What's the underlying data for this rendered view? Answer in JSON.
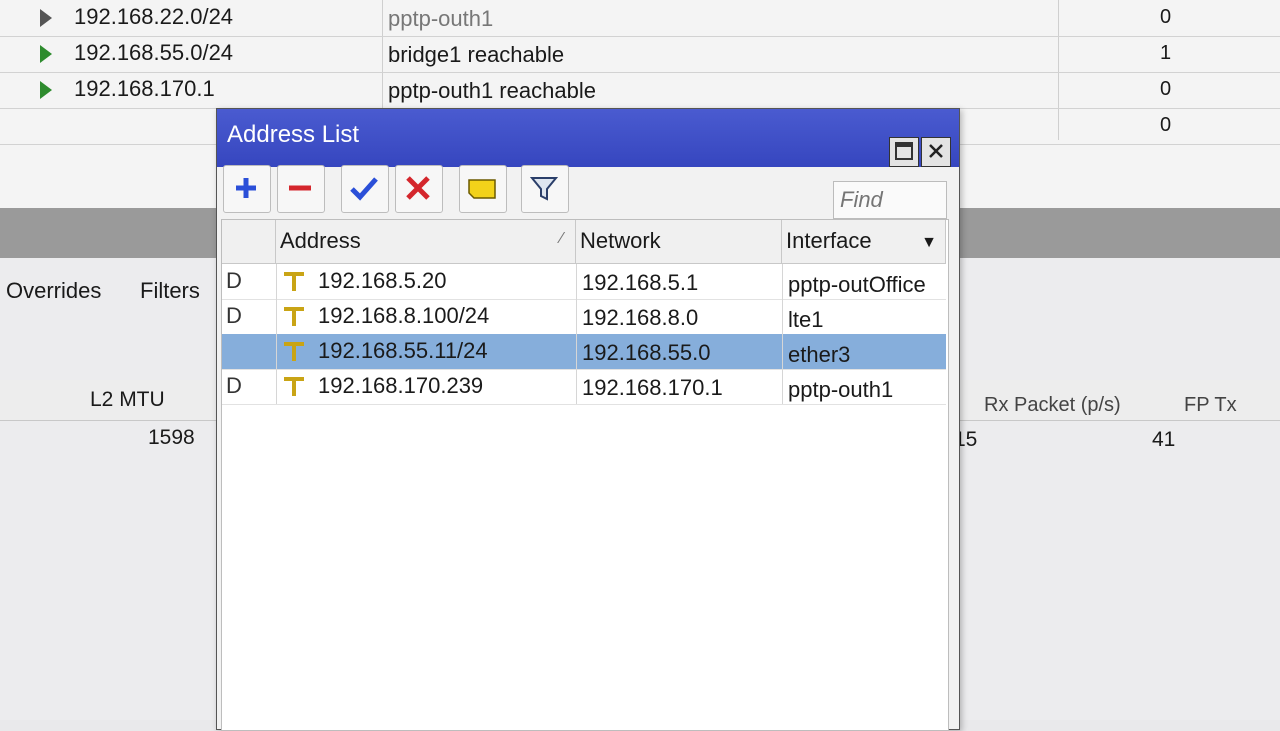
{
  "routes": [
    {
      "dst": "192.168.22.0/24",
      "gateway": "pptp-outh1",
      "distance": "0",
      "active": false
    },
    {
      "dst": "192.168.55.0/24",
      "gateway": "bridge1 reachable",
      "distance": "1",
      "active": true
    },
    {
      "dst": "192.168.170.1",
      "gateway": "pptp-outh1 reachable",
      "distance": "0",
      "active": true
    },
    {
      "dst": "",
      "gateway": "",
      "distance": "0",
      "active": false
    }
  ],
  "background": {
    "tabs": [
      "Overrides",
      "Filters"
    ],
    "l2mtu_header": "L2 MTU",
    "l2mtu_value": "1598",
    "rx_packet_header": "Rx Packet (p/s)",
    "fp_tx_header": "FP Tx",
    "left_value": "15",
    "rx_value": "41"
  },
  "window": {
    "title": "Address List",
    "find_placeholder": "Find",
    "columns": {
      "address": "Address",
      "network": "Network",
      "interface": "Interface"
    },
    "rows": [
      {
        "flag": "D",
        "address": "192.168.5.20",
        "network": "192.168.5.1",
        "interface": "pptp-outOffice",
        "selected": false
      },
      {
        "flag": "D",
        "address": "192.168.8.100/24",
        "network": "192.168.8.0",
        "interface": "lte1",
        "selected": false
      },
      {
        "flag": "",
        "address": "192.168.55.11/24",
        "network": "192.168.55.0",
        "interface": "ether3",
        "selected": true
      },
      {
        "flag": "D",
        "address": "192.168.170.239",
        "network": "192.168.170.1",
        "interface": "pptp-outh1",
        "selected": false
      }
    ]
  },
  "icons": {
    "add": "plus-icon",
    "remove": "minus-icon",
    "enable": "check-icon",
    "disable": "x-icon",
    "comment": "note-icon",
    "filter": "funnel-icon"
  },
  "colors": {
    "titlebar": "#3a4ac4",
    "selection": "#86aedb",
    "active_route": "#2e8b2e"
  }
}
